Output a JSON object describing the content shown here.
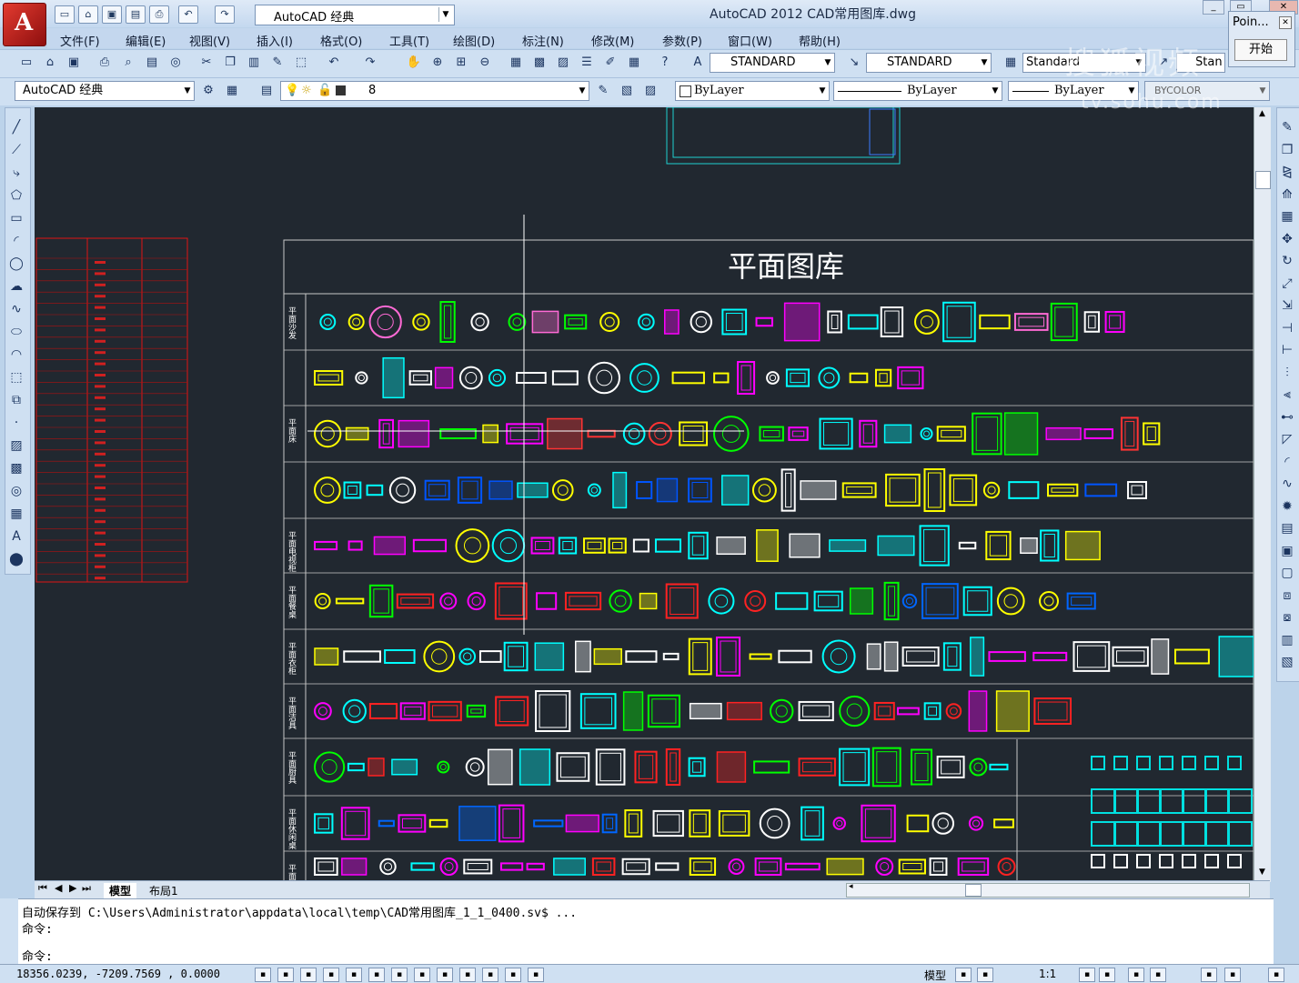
{
  "titlebar": {
    "workspace": "AutoCAD 经典",
    "title": "AutoCAD 2012    CAD常用图库.dwg"
  },
  "menu": [
    "文件(F)",
    "编辑(E)",
    "视图(V)",
    "插入(I)",
    "格式(O)",
    "工具(T)",
    "绘图(D)",
    "标注(N)",
    "修改(M)",
    "参数(P)",
    "窗口(W)",
    "帮助(H)"
  ],
  "popup": {
    "title": "Poin...",
    "button": "开始"
  },
  "watermark": {
    "line1": "搜狐视频",
    "line2": "tv.sohu.com"
  },
  "toolbar1": {
    "text_style": "STANDARD",
    "dim_style": "STANDARD",
    "table_style": "Standard",
    "mleader_style": "Stan"
  },
  "toolbar2": {
    "workspace": "AutoCAD 经典",
    "layer": "8",
    "color": "ByLayer",
    "linetype": "ByLayer",
    "lineweight": "ByLayer",
    "plotstyle": "BYCOLOR"
  },
  "drawing": {
    "title": "平面图库",
    "rows": [
      {
        "label": "平面沙发",
        "colors": [
          "#ff6ad5",
          "#00ffff",
          "#ffffff",
          "#ffff00",
          "#ff00ff",
          "#00ff00"
        ]
      },
      {
        "label": "",
        "colors": [
          "#ff00ff",
          "#ffff00",
          "#00ffff",
          "#ffffff"
        ]
      },
      {
        "label": "平面床",
        "colors": [
          "#ffff00",
          "#ff00ff",
          "#00ffff",
          "#ff3333",
          "#00ff00"
        ]
      },
      {
        "label": "",
        "colors": [
          "#ffff00",
          "#00ffff",
          "#ffffff",
          "#0055ff"
        ]
      },
      {
        "label": "平面电视柜",
        "colors": [
          "#00ffff",
          "#ff00ff",
          "#ffff00",
          "#ffffff"
        ]
      },
      {
        "label": "平面餐桌",
        "colors": [
          "#0066ff",
          "#ffff00",
          "#00ffff",
          "#ff00ff",
          "#ff2222",
          "#00ff00"
        ]
      },
      {
        "label": "平面衣柜",
        "colors": [
          "#00ffff",
          "#ffff00",
          "#ff00ff",
          "#ffffff"
        ]
      },
      {
        "label": "平面洁具",
        "colors": [
          "#00ffff",
          "#ffff00",
          "#ffffff",
          "#ff00ff",
          "#00ff00",
          "#ff2222"
        ]
      },
      {
        "label": "平面厨具",
        "colors": [
          "#00ffff",
          "#ffff00",
          "#00ff00",
          "#ff2222",
          "#ffffff"
        ]
      },
      {
        "label": "平面休闲桌",
        "colors": [
          "#ff00ff",
          "#ffff00",
          "#00ffff",
          "#ffffff",
          "#0066ff"
        ]
      },
      {
        "label": "平面钢琴",
        "colors": [
          "#ff2222",
          "#ffffff",
          "#ff00ff",
          "#ffff00",
          "#00ffff"
        ]
      }
    ]
  },
  "layout_tabs": [
    "模型",
    "布局1"
  ],
  "command": {
    "line1": "自动保存到 C:\\Users\\Administrator\\appdata\\local\\temp\\CAD常用图库_1_1_0400.sv$ ...",
    "line2": "命令:",
    "line3": "命令:"
  },
  "status": {
    "coords": "18356.0239,  -7209.7569 , 0.0000",
    "model": "模型",
    "scale": "1:1"
  }
}
